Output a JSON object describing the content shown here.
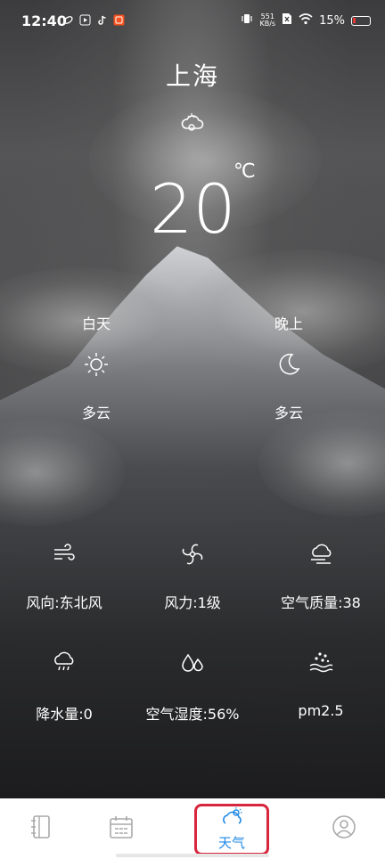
{
  "status_bar": {
    "time": "12:40",
    "app_icons": [
      "leaf-app-icon",
      "play-app-icon",
      "tiktok-app-icon",
      "notification-app-icon"
    ],
    "net_speed_value": "551",
    "net_speed_unit": "KB/s",
    "battery": "15%",
    "battery_color": "#e53935"
  },
  "weather": {
    "city": "上海",
    "current_icon": "cloudy-icon",
    "temperature": "20",
    "temperature_unit": "℃",
    "day": {
      "label": "白天",
      "icon": "sun-icon",
      "condition": "多云"
    },
    "night": {
      "label": "晚上",
      "icon": "moon-icon",
      "condition": "多云"
    },
    "details": [
      {
        "icon": "wind-icon",
        "text": "风向:东北风"
      },
      {
        "icon": "fan-icon",
        "text": "风力:1级"
      },
      {
        "icon": "haze-icon",
        "text": "空气质量:38"
      },
      {
        "icon": "rain-icon",
        "text": "降水量:0"
      },
      {
        "icon": "humidity-icon",
        "text": "空气湿度:56%"
      },
      {
        "icon": "pm-icon",
        "text": "pm2.5"
      }
    ]
  },
  "tabbar": {
    "tabs": [
      {
        "icon": "notebook-icon",
        "label": ""
      },
      {
        "icon": "calendar-icon",
        "label": ""
      },
      {
        "icon": "weather-icon",
        "label": "天气",
        "active": true
      },
      {
        "icon": "profile-icon",
        "label": ""
      }
    ],
    "active_color": "#1e88e5",
    "highlight_color": "#d7263d"
  }
}
